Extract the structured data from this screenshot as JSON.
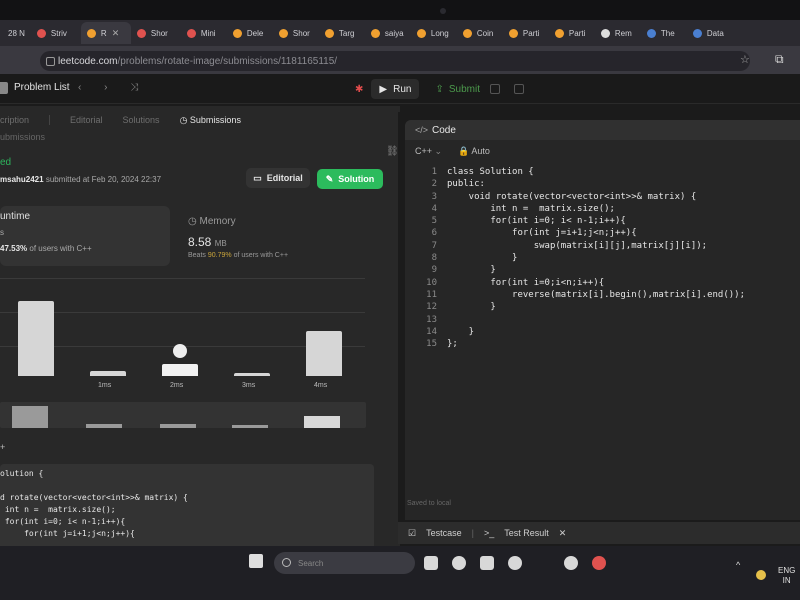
{
  "browser": {
    "clock_fragment": "28 N",
    "tabs": [
      {
        "label": "Striv",
        "color": "#e0524f",
        "active": false
      },
      {
        "label": "R",
        "color": "#f0a030",
        "active": true
      },
      {
        "label": "Shor",
        "color": "#e0524f",
        "active": false
      },
      {
        "label": "Mini",
        "color": "#e0524f",
        "active": false
      },
      {
        "label": "Dele",
        "color": "#f0a030",
        "active": false
      },
      {
        "label": "Shor",
        "color": "#f0a030",
        "active": false
      },
      {
        "label": "Targ",
        "color": "#f0a030",
        "active": false
      },
      {
        "label": "saiya",
        "color": "#f0a030",
        "active": false
      },
      {
        "label": "Long",
        "color": "#f0a030",
        "active": false
      },
      {
        "label": "Coin",
        "color": "#f0a030",
        "active": false
      },
      {
        "label": "Parti",
        "color": "#f0a030",
        "active": false
      },
      {
        "label": "Parti",
        "color": "#f0a030",
        "active": false
      },
      {
        "label": "Rem",
        "color": "#dddddd",
        "active": false
      },
      {
        "label": "The",
        "color": "#4a7fd0",
        "active": false
      },
      {
        "label": "Data",
        "color": "#4a7fd0",
        "active": false
      }
    ],
    "close_glyph": "✕",
    "url_host": "leetcode.com",
    "url_path": "/problems/rotate-image/submissions/1181165115/"
  },
  "lc_header": {
    "problem_list": "Problem List",
    "nav_glyphs": "‹ › ⤨",
    "run": "Run",
    "submit": "Submit"
  },
  "left": {
    "tabs": [
      "cription",
      "Editorial",
      "Solutions",
      "Submissions"
    ],
    "subheading": "ubmissions",
    "status": "ed",
    "submitter_name": "msahu2421",
    "submitted_at": "submitted at Feb 20, 2024 22:37",
    "editorial_btn": "Editorial",
    "solution_btn": "Solution",
    "runtime": {
      "label": "untime",
      "value": "s",
      "beats_pct": "47.53%",
      "beats_suffix": "of users with C++"
    },
    "memory": {
      "label": "Memory",
      "value": "8.58",
      "unit": "MB",
      "beats_prefix": "Beats",
      "beats_pct": "90.79%",
      "beats_suffix": "of users with C++"
    },
    "chart_ticks": [
      "1ms",
      "2ms",
      "3ms",
      "4ms"
    ],
    "code_header": "+",
    "code_lines": [
      "olution {",
      "",
      "d rotate(vector<vector<int>>& matrix) {",
      " int n =  matrix.size();",
      " for(int i=0; i< n-1;i++){",
      "     for(int j=i+1;j<n;j++){"
    ]
  },
  "chart_data": {
    "type": "bar",
    "categories": [
      "",
      "1ms",
      "2ms",
      "3ms",
      "4ms"
    ],
    "values": [
      0.75,
      0.05,
      0.12,
      0.03,
      0.45
    ],
    "ylim": [
      0,
      1
    ]
  },
  "editor": {
    "title": "Code",
    "language": "C++",
    "mode": "Auto",
    "lines": [
      "class Solution {",
      "public:",
      "    void rotate(vector<vector<int>>& matrix) {",
      "        int n =  matrix.size();",
      "        for(int i=0; i< n-1;i++){",
      "            for(int j=i+1;j<n;j++){",
      "                swap(matrix[i][j],matrix[j][i]);",
      "            }",
      "        }",
      "        for(int i=0;i<n;i++){",
      "            reverse(matrix[i].begin(),matrix[i].end());",
      "        }",
      "",
      "    }",
      "};"
    ],
    "saved": "Saved to local",
    "result_tabs": [
      "Testcase",
      "Test Result"
    ]
  },
  "taskbar": {
    "search_placeholder": "Search",
    "lang_line1": "ENG",
    "lang_line2": "IN"
  }
}
